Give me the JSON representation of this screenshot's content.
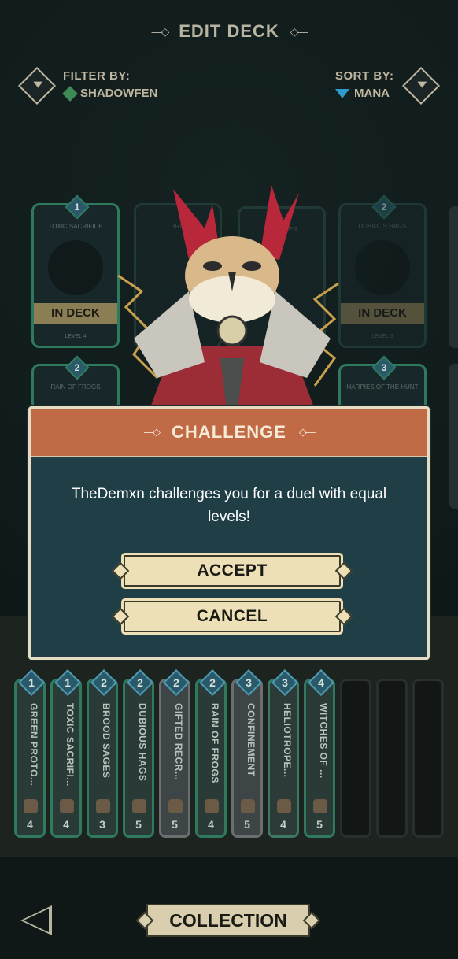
{
  "header": {
    "title": "EDIT DECK"
  },
  "filter": {
    "label": "FILTER BY:",
    "value": "SHADOWFEN"
  },
  "sort": {
    "label": "SORT BY:",
    "value": "MANA"
  },
  "grid_cards": [
    {
      "cost": "1",
      "name": "TOXIC SACRIFICE",
      "status": "IN DECK",
      "level": "LEVEL 4"
    },
    {
      "cost": "",
      "name": "BRO",
      "status": "",
      "level": ""
    },
    {
      "cost": "",
      "name": "CHANGER",
      "status": "",
      "level": ""
    },
    {
      "cost": "2",
      "name": "DUBIOUS HAGS",
      "status": "IN DECK",
      "level": "LEVEL 5"
    },
    {
      "cost": "2",
      "name": "RAIN OF FROGS",
      "status": "",
      "level": ""
    },
    {
      "cost": "3",
      "name": "HARPIES OF THE HUNT",
      "status": "",
      "level": ""
    }
  ],
  "modal": {
    "title": "CHALLENGE",
    "message": "TheDemxn challenges you for a duel with equal levels!",
    "accept_label": "ACCEPT",
    "cancel_label": "CANCEL"
  },
  "deck": [
    {
      "cost": "1",
      "name": "GREEN PROTO...",
      "level": "4"
    },
    {
      "cost": "1",
      "name": "TOXIC SACRIFI...",
      "level": "4"
    },
    {
      "cost": "2",
      "name": "BROOD SAGES",
      "level": "3"
    },
    {
      "cost": "2",
      "name": "DUBIOUS HAGS",
      "level": "5"
    },
    {
      "cost": "2",
      "name": "GIFTED RECR...",
      "level": "5"
    },
    {
      "cost": "2",
      "name": "RAIN OF FROGS",
      "level": "4"
    },
    {
      "cost": "3",
      "name": "CONFINEMENT",
      "level": "5"
    },
    {
      "cost": "3",
      "name": "HELIOTROPE...",
      "level": "4"
    },
    {
      "cost": "4",
      "name": "WITCHES OF ...",
      "level": "5"
    }
  ],
  "bottom": {
    "collection_label": "COLLECTION"
  }
}
